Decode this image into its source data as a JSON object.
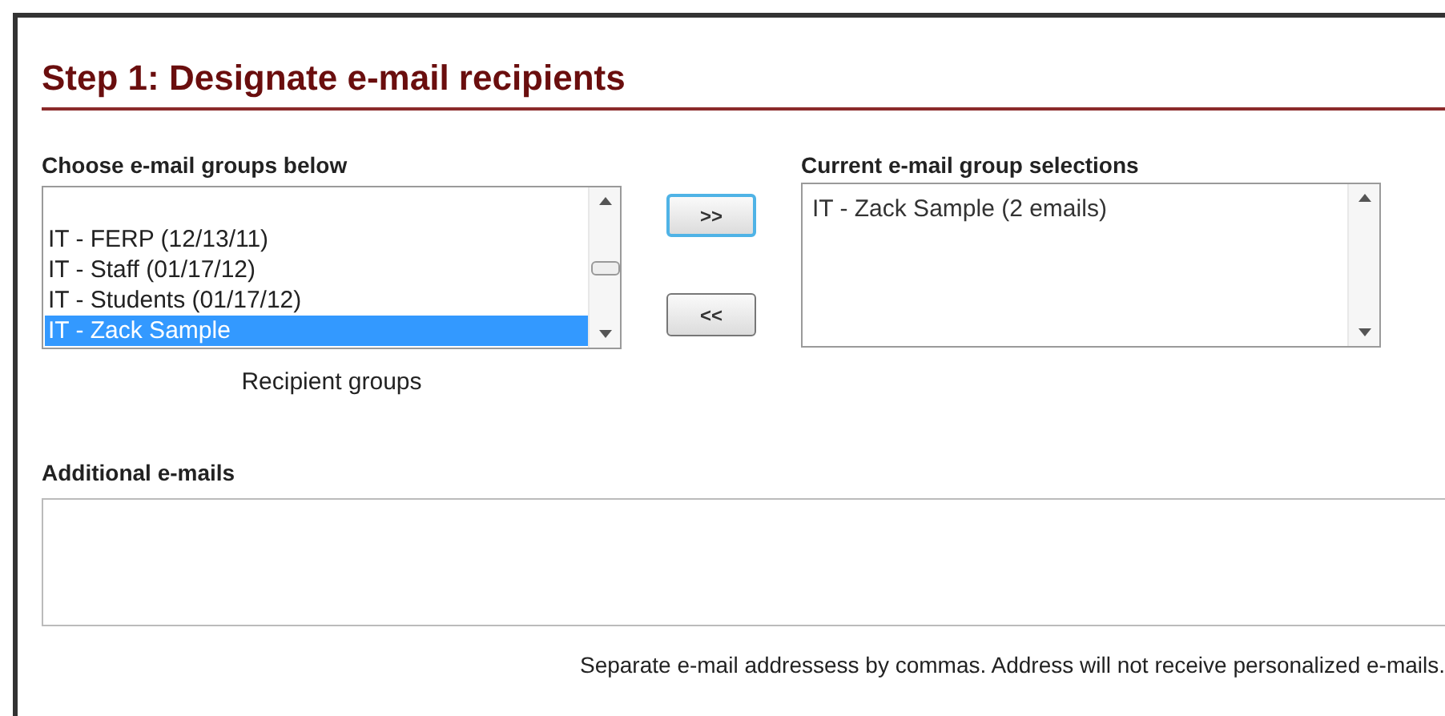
{
  "title": "Step 1: Designate e-mail recipients",
  "groups": {
    "label": "Choose e-mail groups below",
    "items": [
      {
        "text": "IT - FERP (12/13/11)",
        "selected": false
      },
      {
        "text": "IT - Staff (01/17/12)",
        "selected": false
      },
      {
        "text": "IT - Students (01/17/12)",
        "selected": false
      },
      {
        "text": "IT - Zack Sample",
        "selected": true
      }
    ],
    "caption": "Recipient groups"
  },
  "buttons": [
    {
      "label": ">>",
      "focused": true
    },
    {
      "label": "<<",
      "focused": false
    }
  ],
  "selections": {
    "label": "Current e-mail group selections",
    "items": [
      "IT - Zack Sample (2 emails)"
    ]
  },
  "additional": {
    "label": "Additional e-mails",
    "hint": "Separate e-mail addressess by commas. Address will not receive personalized e-mails."
  }
}
